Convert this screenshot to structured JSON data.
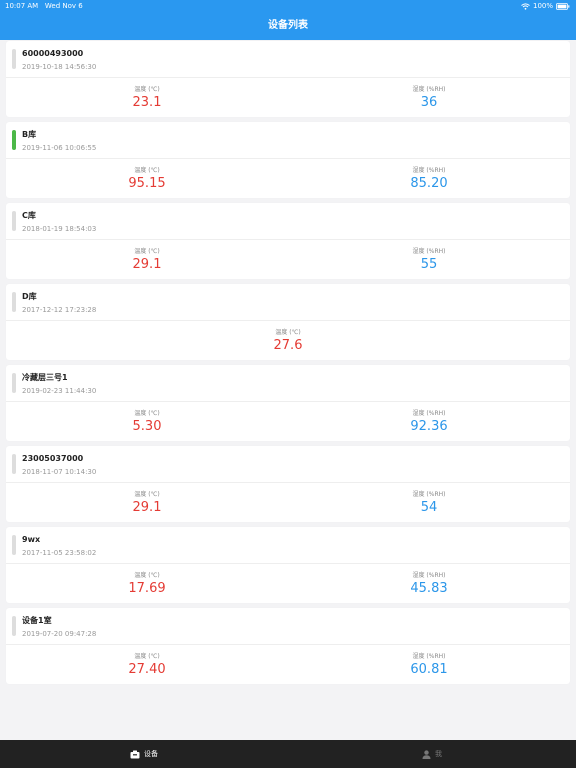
{
  "status_bar": {
    "time": "10:07 AM",
    "date": "Wed Nov 6",
    "battery": "100%"
  },
  "header": {
    "title": "设备列表"
  },
  "devices": [
    {
      "name": "60000493000",
      "time": "2019-10-18 14:56:30",
      "active": false,
      "temp_label": "温度 (℃)",
      "temp_value": "23.1",
      "hum_label": "湿度 (%RH)",
      "hum_value": "36"
    },
    {
      "name": "B库",
      "time": "2019-11-06 10:06:55",
      "active": true,
      "temp_label": "温度 (℃)",
      "temp_value": "95.15",
      "hum_label": "湿度 (%RH)",
      "hum_value": "85.20"
    },
    {
      "name": "C库",
      "time": "2018-01-19 18:54:03",
      "active": false,
      "temp_label": "温度 (℃)",
      "temp_value": "29.1",
      "hum_label": "湿度 (%RH)",
      "hum_value": "55"
    },
    {
      "name": "D库",
      "time": "2017-12-12 17:23:28",
      "active": false,
      "temp_label": "温度 (℃)",
      "temp_value": "27.6"
    },
    {
      "name": "冷藏层三号1",
      "time": "2019-02-23 11:44:30",
      "active": false,
      "temp_label": "温度 (℃)",
      "temp_value": "5.30",
      "hum_label": "湿度 (%RH)",
      "hum_value": "92.36"
    },
    {
      "name": "23005037000",
      "time": "2018-11-07 10:14:30",
      "active": false,
      "temp_label": "温度 (℃)",
      "temp_value": "29.1",
      "hum_label": "湿度 (%RH)",
      "hum_value": "54"
    },
    {
      "name": "9wx",
      "time": "2017-11-05 23:58:02",
      "active": false,
      "temp_label": "温度 (℃)",
      "temp_value": "17.69",
      "hum_label": "湿度 (%RH)",
      "hum_value": "45.83"
    },
    {
      "name": "设备1室",
      "time": "2019-07-20 09:47:28",
      "active": false,
      "temp_label": "温度 (℃)",
      "temp_value": "27.40",
      "hum_label": "湿度 (%RH)",
      "hum_value": "60.81"
    }
  ],
  "tabbar": {
    "devices_label": "设备",
    "me_label": "我"
  },
  "colors": {
    "header_bg": "#2a98f0",
    "temp_color": "#e43b34",
    "humidity_color": "#2b96e9",
    "active_indicator": "#4cb848",
    "inactive_indicator": "#dddddd",
    "tabbar_bg": "#222222"
  },
  "icons": {
    "status_wifi": "wifi-icon",
    "status_battery": "battery-icon",
    "tab_devices": "device-icon",
    "tab_me": "user-icon"
  }
}
